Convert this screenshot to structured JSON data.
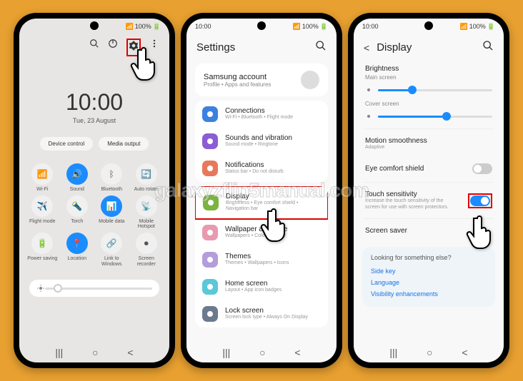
{
  "watermark": "galaxyzflip5manual.com",
  "status": {
    "time": "10:00",
    "battery": "100%"
  },
  "phone1": {
    "clock_time": "10:00",
    "clock_date": "Tue, 23 August",
    "chips": [
      "Device control",
      "Media output"
    ],
    "qs": [
      {
        "label": "Wi-Fi",
        "on": false
      },
      {
        "label": "Sound",
        "on": true
      },
      {
        "label": "Bluetooth",
        "on": false
      },
      {
        "label": "Auto rotate",
        "on": false
      },
      {
        "label": "Flight mode",
        "on": false
      },
      {
        "label": "Torch",
        "on": false
      },
      {
        "label": "Mobile data",
        "on": true
      },
      {
        "label": "Mobile Hotspot",
        "on": false
      },
      {
        "label": "Power saving",
        "on": false
      },
      {
        "label": "Location",
        "on": true
      },
      {
        "label": "Link to Windows",
        "on": false
      },
      {
        "label": "Screen recorder",
        "on": false
      }
    ]
  },
  "phone2": {
    "title": "Settings",
    "account": {
      "title": "Samsung account",
      "sub": "Profile • Apps and features"
    },
    "items": [
      {
        "title": "Connections",
        "sub": "Wi-Fi • Bluetooth • Flight mode",
        "color": "#3b82e0"
      },
      {
        "title": "Sounds and vibration",
        "sub": "Sound mode • Ringtone",
        "color": "#8b5cd6"
      },
      {
        "title": "Notifications",
        "sub": "Status bar • Do not disturb",
        "color": "#e8785c"
      },
      {
        "title": "Display",
        "sub": "Brightness • Eye comfort shield • Navigation bar",
        "color": "#7cb342",
        "hl": true
      },
      {
        "title": "Wallpaper and style",
        "sub": "Wallpapers • Colour palette",
        "color": "#e89ab0"
      },
      {
        "title": "Themes",
        "sub": "Themes • Wallpapers • Icons",
        "color": "#b39ddb"
      },
      {
        "title": "Home screen",
        "sub": "Layout • App icon badges",
        "color": "#5ac8d8"
      },
      {
        "title": "Lock screen",
        "sub": "Screen lock type • Always On Display",
        "color": "#6b7a8f"
      }
    ]
  },
  "phone3": {
    "title": "Display",
    "brightness": "Brightness",
    "main_screen": "Main screen",
    "cover_screen": "Cover screen",
    "rows": [
      {
        "title": "Motion smoothness",
        "sub": "Adaptive"
      },
      {
        "title": "Eye comfort shield",
        "toggle": false
      },
      {
        "title": "Touch sensitivity",
        "sub": "Increase the touch sensitivity of the screen for use with screen protectors.",
        "toggle": true,
        "hl": true
      },
      {
        "title": "Screen saver"
      }
    ],
    "lookfor": {
      "heading": "Looking for something else?",
      "links": [
        "Side key",
        "Language",
        "Visibility enhancements"
      ]
    }
  }
}
